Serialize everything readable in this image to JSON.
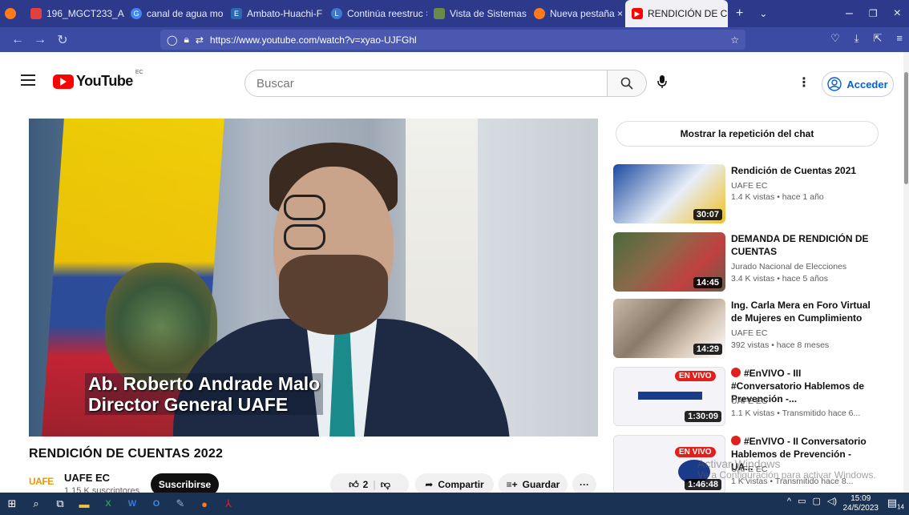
{
  "browser": {
    "tabs": [
      {
        "label": "196_MGCT233_A3 ×",
        "icon_color": "#e04040",
        "icon": "document-icon"
      },
      {
        "label": "canal de agua mo ×",
        "icon_color": "#4285f4",
        "icon": "google-icon"
      },
      {
        "label": "Ambato-Huachi-F ×",
        "icon_color": "#2a6ab0",
        "icon": "eh-icon"
      },
      {
        "label": "Continúa reestruc ×",
        "icon_color": "#3a7ad0",
        "icon": "ln-icon"
      },
      {
        "label": "Vista de Sistemas ×",
        "icon_color": "#6a8a4a",
        "icon": "image-icon"
      },
      {
        "label": "Nueva pestaña ×",
        "icon_color": "#ff7a1a",
        "icon": "firefox-icon"
      }
    ],
    "active_tab": {
      "label": "RENDICIÓN DE CL",
      "close": "×",
      "icon_color": "#ff0000"
    },
    "new_tab": "+",
    "url": "https://www.youtube.com/watch?v=xyao-UJFGhl"
  },
  "youtube": {
    "logo_text": "YouTube",
    "country_code": "EC",
    "search_placeholder": "Buscar",
    "sign_in": "Acceder"
  },
  "video": {
    "overlay_line1": "Ab. Roberto Andrade Malo",
    "overlay_line2": "Director General UAFE",
    "title": "RENDICIÓN DE CUENTAS 2022",
    "channel_logo": "UAFE",
    "channel": "UAFE EC",
    "subscribers": "1,15 K suscriptores",
    "subscribe": "Suscribirse",
    "likes": "2",
    "share": "Compartir",
    "save": "Guardar",
    "more": "···"
  },
  "chat_replay": "Mostrar la repetición del chat",
  "recommendations": [
    {
      "title": "Rendición de Cuentas 2021",
      "channel": "UAFE EC",
      "meta": "1.4 K vistas • hace 1 año",
      "duration": "30:07",
      "live": false,
      "thumb": "#1a4aa0"
    },
    {
      "title": "DEMANDA DE RENDICIÓN DE CUENTAS",
      "channel": "Jurado Nacional de Elecciones",
      "meta": "3.4 K vistas • hace 5 años",
      "duration": "14:45",
      "live": false,
      "thumb": "#6a5a3a"
    },
    {
      "title": "Ing. Carla Mera en Foro Virtual de Mujeres en Cumplimiento",
      "channel": "UAFE EC",
      "meta": "392 vistas • hace 8 meses",
      "duration": "14:29",
      "live": false,
      "thumb": "#8a7a6a"
    },
    {
      "title": "#EnVIVO - III #Conversatorio Hablemos de Prevención -...",
      "channel": "UAFE EC",
      "meta": "1.1 K vistas • Transmitido hace 6...",
      "duration": "1:30:09",
      "live": true,
      "thumb": "#f4f4f8",
      "badge": "EN VIVO"
    },
    {
      "title": "#EnVIVO - II Conversatorio Hablemos de Prevención - UA...",
      "channel": "UAFE EC",
      "meta": "1 K vistas • Transmitido hace 8...",
      "duration": "1:46:48",
      "live": true,
      "thumb": "#f4f4f8",
      "badge": "EN VIVO"
    }
  ],
  "watermark": {
    "line1": "Activar Windows",
    "line2": "Ve a Configuración para activar Windows."
  },
  "taskbar": {
    "time": "15:09",
    "date": "24/5/2023",
    "notifications": "14"
  }
}
